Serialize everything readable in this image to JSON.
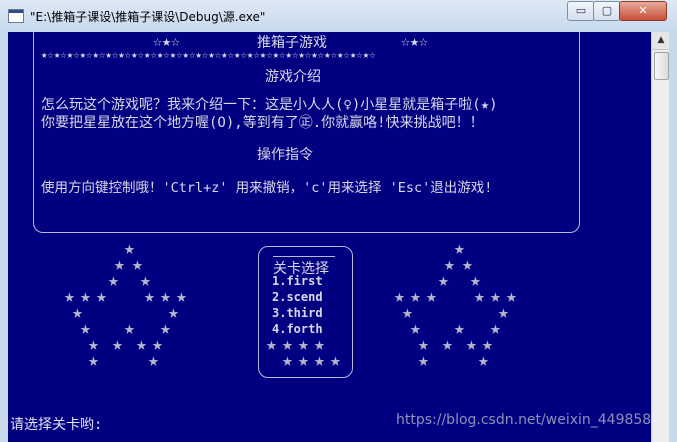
{
  "window": {
    "title": "\"E:\\推箱子课设\\推箱子课设\\Debug\\源.exe\""
  },
  "controls": {
    "minimize": "▭",
    "maximize": "▢",
    "close": "✕"
  },
  "console": {
    "header_stars_left": "☆★☆",
    "title": "推箱子游戏",
    "header_stars_right": "☆★☆",
    "star_row": "★☆★☆★☆★☆★☆★☆★☆★☆★☆★☆★☆★☆★☆★☆★☆★☆★☆★☆★☆★☆★☆★☆★☆★☆★☆★☆",
    "intro_heading": "游戏介绍",
    "intro_line1": "怎么玩这个游戏呢？我来介绍一下：这是小人人(♀)小星星就是箱子啦(★)",
    "intro_line2": "你要把星星放在这个地方喔(O),等到有了㊣.你就赢咯!快来挑战吧！！",
    "controls_heading": "操作指令",
    "controls_line": "使用方向键控制哦！'Ctrl+z' 用来撤销，'c'用来选择 'Esc'退出游戏!",
    "menu_title": "关卡选择",
    "menu_items": [
      "1.first",
      "2.scend",
      "3.third",
      "4.forth"
    ],
    "prompt": "请选择关卡哟:",
    "watermark": "https://blog.csdn.net/weixin_449858"
  }
}
